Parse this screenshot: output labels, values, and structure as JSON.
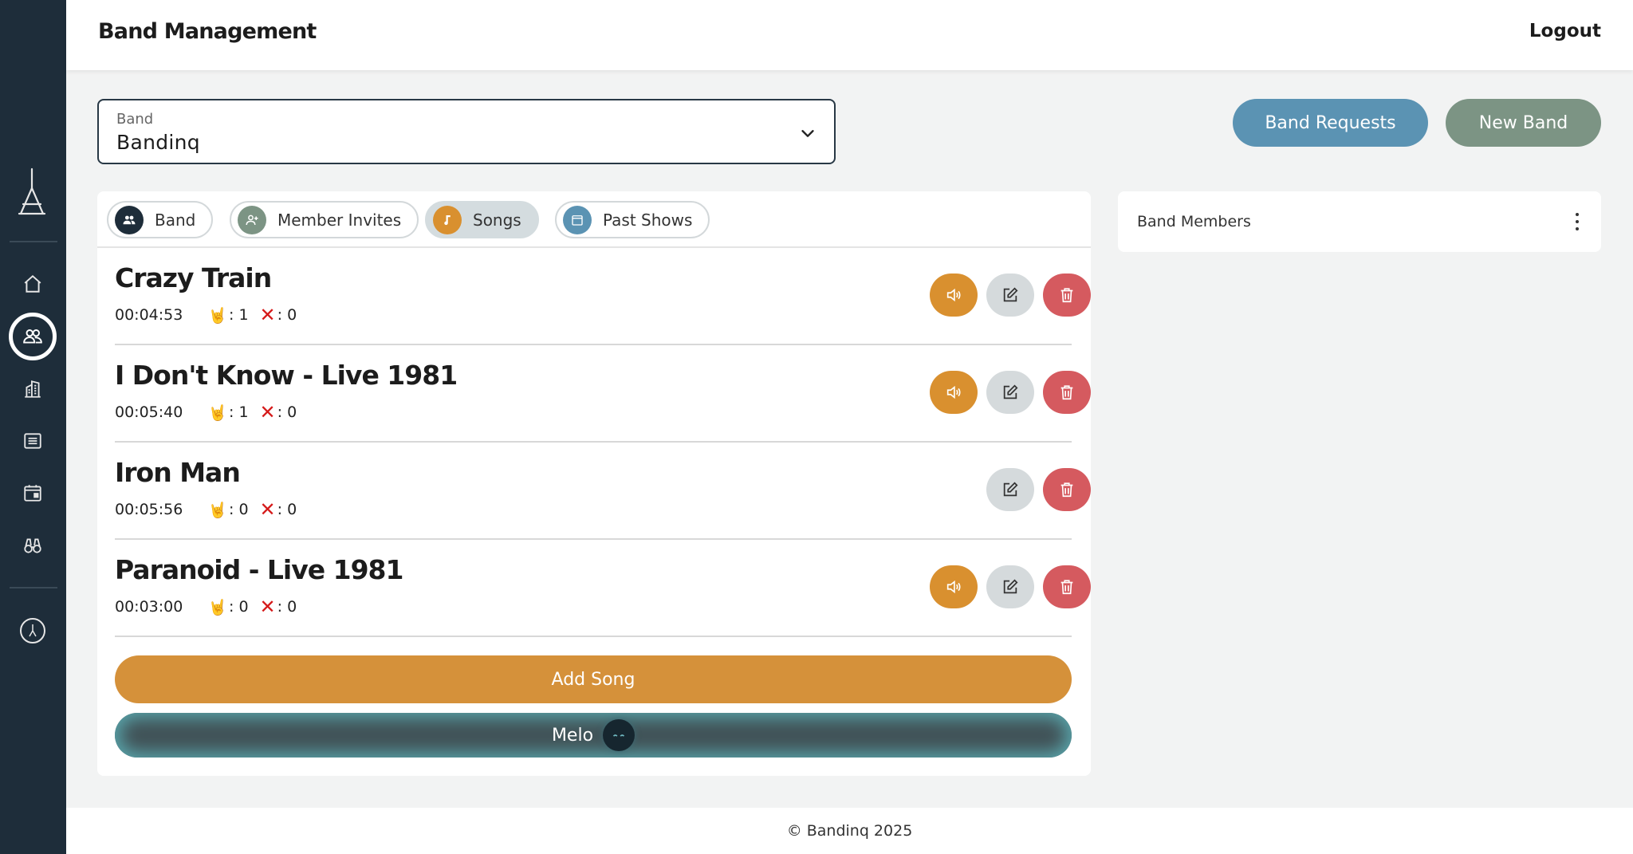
{
  "header": {
    "title": "Band Management",
    "logout_label": "Logout"
  },
  "sidebar": {
    "items": [
      {
        "name": "home",
        "icon": "home-icon"
      },
      {
        "name": "bands",
        "icon": "people-icon",
        "active": true
      },
      {
        "name": "venues",
        "icon": "building-icon"
      },
      {
        "name": "lists",
        "icon": "list-icon"
      },
      {
        "name": "calendar",
        "icon": "calendar-icon"
      },
      {
        "name": "discover",
        "icon": "binoculars-icon"
      },
      {
        "name": "profile",
        "icon": "avatar-icon"
      }
    ]
  },
  "band_select": {
    "label": "Band",
    "value": "Bandinq"
  },
  "actions": {
    "requests_label": "Band Requests",
    "new_band_label": "New Band"
  },
  "tabs": [
    {
      "label": "Band",
      "icon": "people-icon",
      "color": "#1e2d3a"
    },
    {
      "label": "Member Invites",
      "icon": "add-user-icon",
      "color": "#7c9484"
    },
    {
      "label": "Songs",
      "icon": "music-note-icon",
      "color": "#d9902f",
      "active": true
    },
    {
      "label": "Past Shows",
      "icon": "calendar-icon",
      "color": "#5b93b3"
    }
  ],
  "songs": [
    {
      "title": "Crazy Train",
      "duration": "00:04:53",
      "rock_label": ": 1",
      "x_label": ": 0",
      "has_audio": true
    },
    {
      "title": "I Don't Know - Live 1981",
      "duration": "00:05:40",
      "rock_label": ": 1",
      "x_label": ": 0",
      "has_audio": true
    },
    {
      "title": "Iron Man",
      "duration": "00:05:56",
      "rock_label": ": 0",
      "x_label": ": 0",
      "has_audio": false
    },
    {
      "title": "Paranoid - Live 1981",
      "duration": "00:03:00",
      "rock_label": ": 0",
      "x_label": ": 0",
      "has_audio": true
    }
  ],
  "add_song_label": "Add Song",
  "melo_label": "Melo",
  "members": {
    "title": "Band Members"
  },
  "footer": {
    "text": "© Bandinq 2025"
  },
  "colors": {
    "sidebar": "#1e2d3a",
    "accent_orange": "#d5913a",
    "danger": "#d55a5f",
    "blue": "#5b93b3",
    "sage": "#7c9484"
  }
}
